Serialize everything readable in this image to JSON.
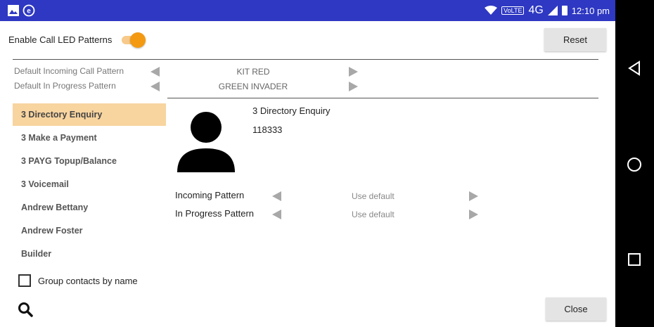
{
  "status_bar": {
    "network_label": "VoLTE",
    "network_type": "4G",
    "time": "12:10 pm",
    "left_icons": [
      "image-icon",
      "e-circle-icon"
    ],
    "background": "#2e38c2"
  },
  "header": {
    "enable_label": "Enable Call LED Patterns",
    "toggle_on": true,
    "reset_label": "Reset",
    "accent": "#f39a12"
  },
  "defaults": {
    "incoming_label": "Default Incoming Call Pattern",
    "incoming_value": "KIT RED",
    "in_progress_label": "Default In Progress Pattern",
    "in_progress_value": "GREEN INVADER"
  },
  "contacts": [
    {
      "label": "3 Directory Enquiry",
      "selected": true
    },
    {
      "label": "3 Make a Payment"
    },
    {
      "label": "3 PAYG Topup/Balance"
    },
    {
      "label": "3 Voicemail"
    },
    {
      "label": "Andrew Bettany"
    },
    {
      "label": "Andrew Foster"
    },
    {
      "label": "Builder"
    }
  ],
  "group_contacts": {
    "label": "Group contacts by name",
    "checked": false
  },
  "detail": {
    "name": "3 Directory Enquiry",
    "number": "118333",
    "incoming_label": "Incoming Pattern",
    "incoming_value": "Use default",
    "in_progress_label": "In Progress Pattern",
    "in_progress_value": "Use default"
  },
  "footer": {
    "close_label": "Close"
  }
}
